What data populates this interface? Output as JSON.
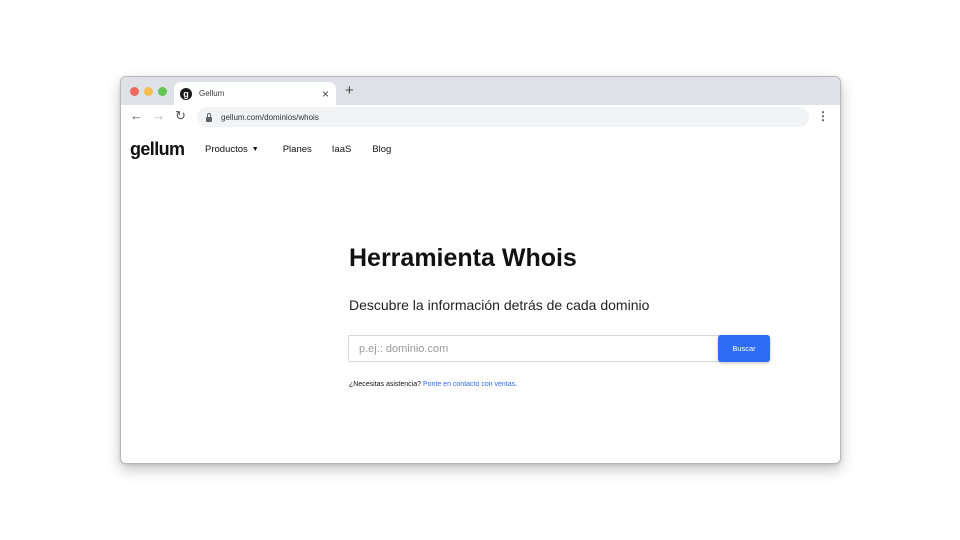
{
  "browser": {
    "tab_title": "Gellum",
    "tab_favicon_letter": "g",
    "tab_close": "×",
    "new_tab": "+",
    "url": "gellum.com/dominios/whois",
    "icons": [
      "back-arrow-icon",
      "forward-arrow-icon",
      "reload-icon",
      "lock-icon",
      "kebab-menu-icon"
    ]
  },
  "site": {
    "logo": "gellum",
    "nav": {
      "productos": "Productos",
      "planes": "Planes",
      "iaas": "IaaS",
      "blog": "Blog"
    }
  },
  "hero": {
    "title": "Herramienta Whois",
    "subtitle": "Descubre la información detrás de cada dominio",
    "search_placeholder": "p.ej.: dominio.com",
    "search_value": "",
    "search_button": "Buscar",
    "help_text": "¿Necesitas asistencia?",
    "help_link": "Ponte en contacto con ventas",
    "help_period": "."
  },
  "colors": {
    "accent": "#2e6cf6",
    "tab_strip": "#dee1e6",
    "traffic_red": "#ed6a5e",
    "traffic_yellow": "#f5bf4f",
    "traffic_green": "#61c554"
  }
}
